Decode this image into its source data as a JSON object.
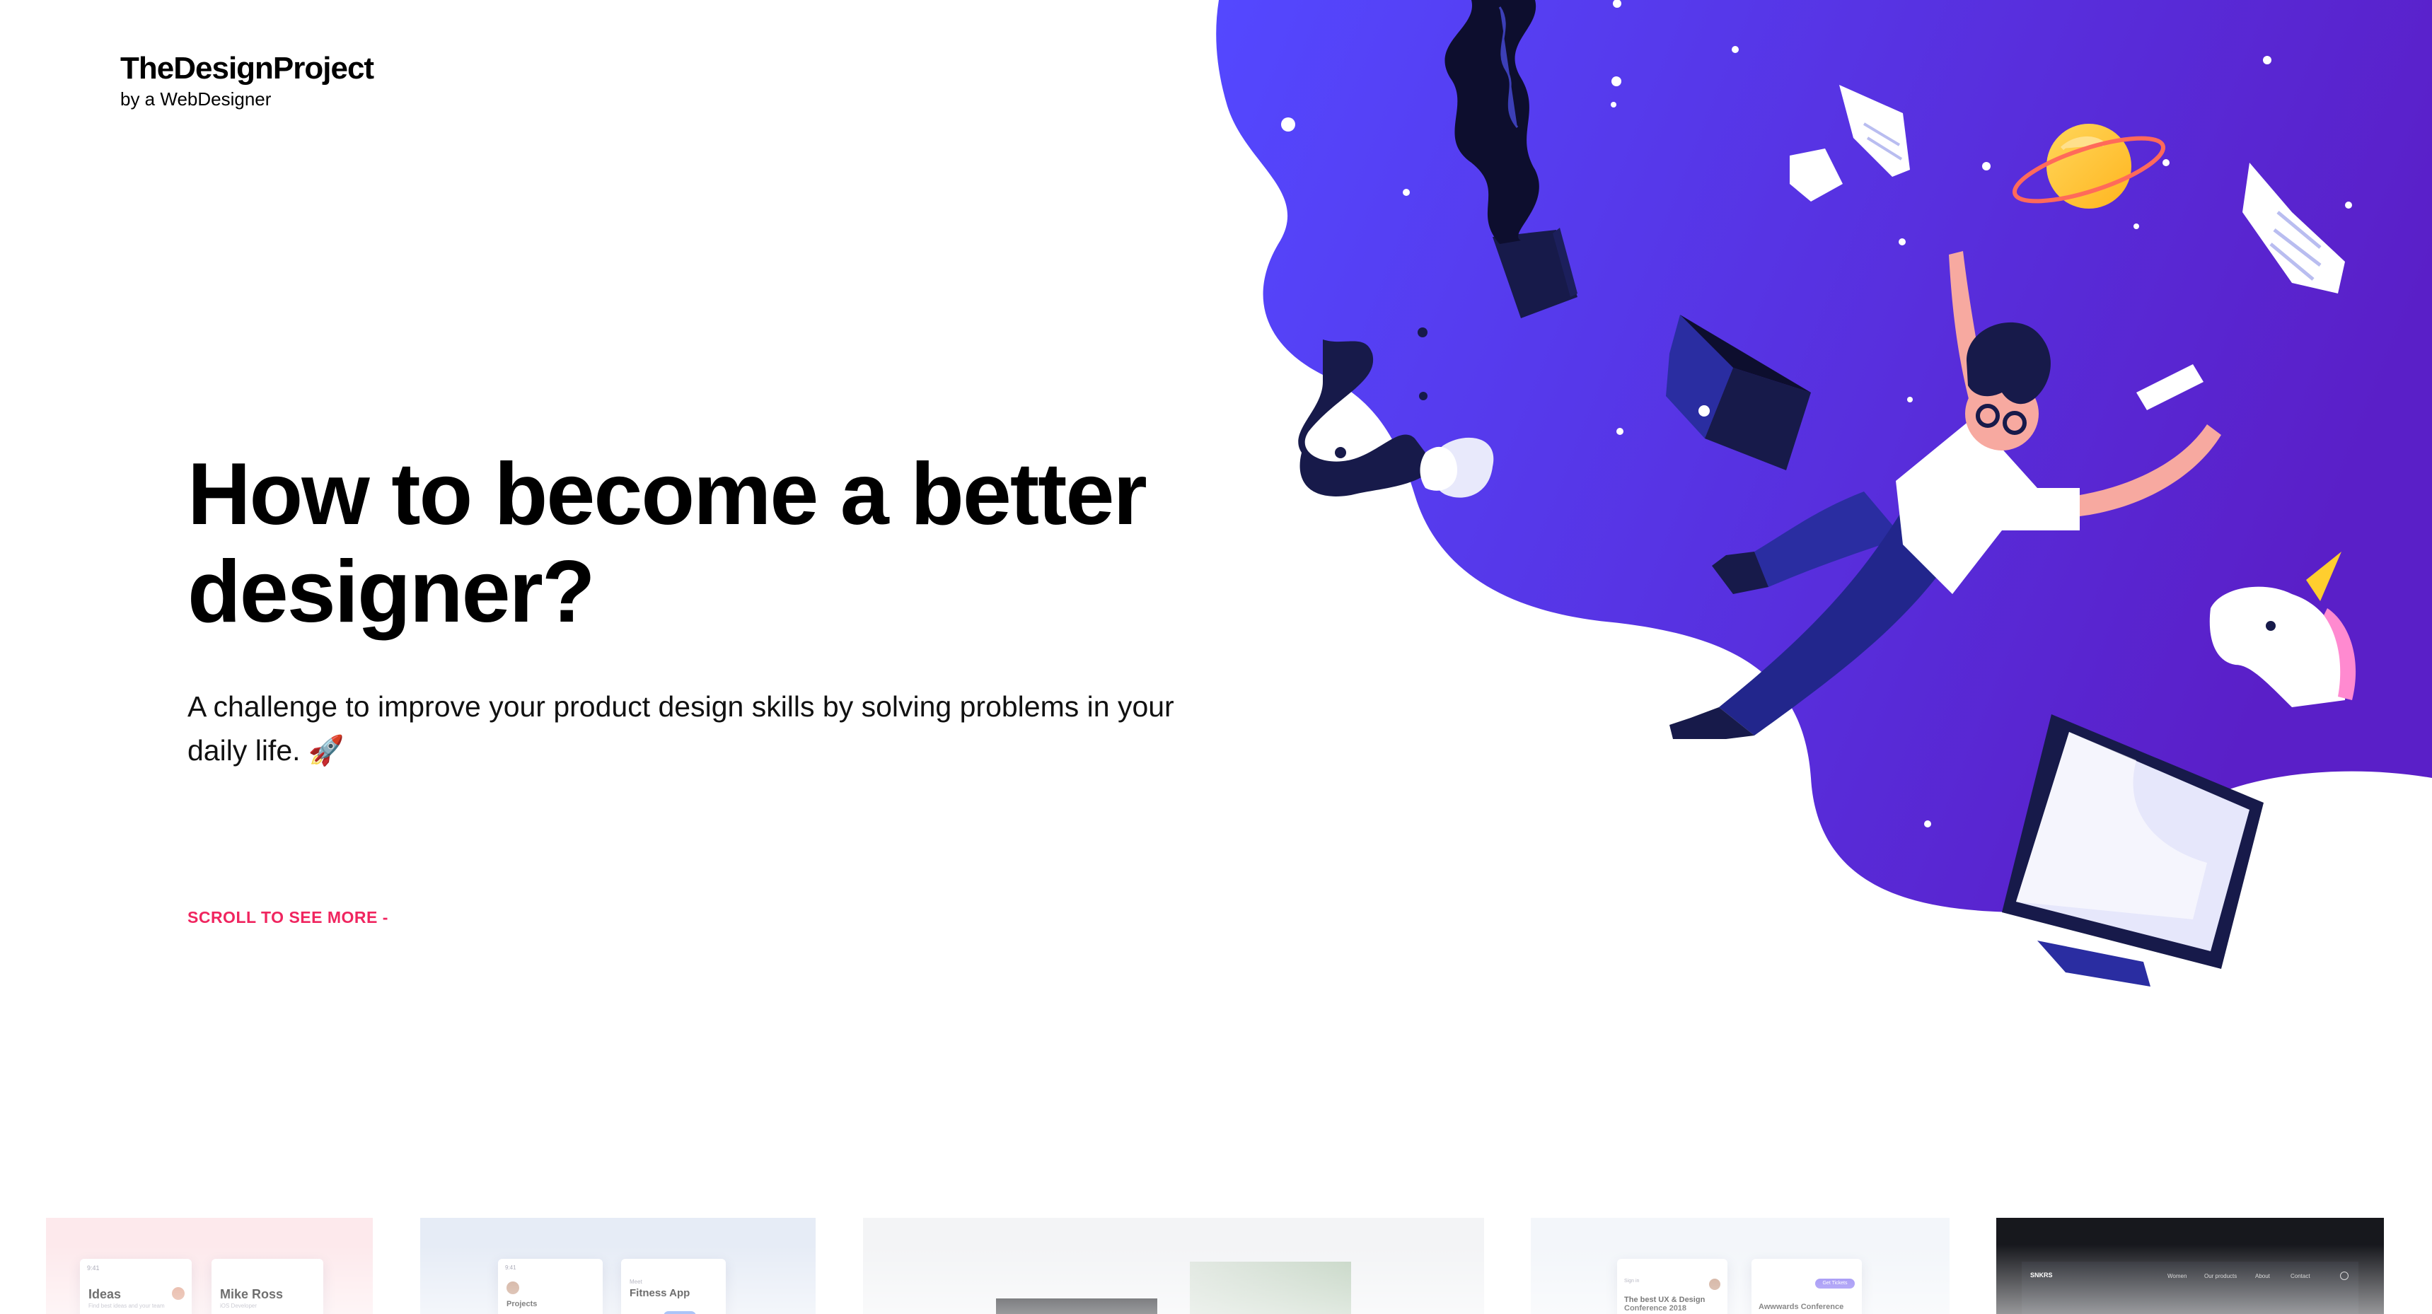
{
  "brand": {
    "name": "TheDesignProject",
    "tagline": "by a WebDesigner"
  },
  "hero": {
    "title": "How to become a better designer?",
    "subtitle": "A challenge to improve your product design skills by solving problems in your daily life.",
    "emoji": "🚀",
    "scroll_cta": "SCROLL TO SEE MORE -"
  },
  "colors": {
    "accent": "#f0255f",
    "illustration_gradient_start": "#5448ff",
    "illustration_gradient_end": "#5a1fc8",
    "planet": "#ffc53a",
    "text": "#000000"
  },
  "projects": [
    {
      "id": "ideas",
      "bg": "#fde9ec",
      "cards": [
        {
          "title": "Ideas",
          "caption": "Find best ideas and your team"
        },
        {
          "title": "Mike Ross",
          "caption": "iOS Developer"
        }
      ]
    },
    {
      "id": "fitness",
      "bg": "#e6ecf6",
      "cards": [
        {
          "title": "Projects",
          "caption": "9:41"
        },
        {
          "title": "Fitness App",
          "caption": "Meet"
        }
      ]
    },
    {
      "id": "plant",
      "bg": "#f3f4f6",
      "cards": []
    },
    {
      "id": "conference",
      "bg": "#f3f6fa",
      "cards": [
        {
          "title": "The best UX & Design Conference 2018",
          "caption": "Sign in"
        },
        {
          "title": "Awwwards Conference",
          "caption": "Get Tickets"
        }
      ]
    },
    {
      "id": "sneakers",
      "bg": "#17181d",
      "nav": [
        "SNKRS",
        "Women",
        "Our products",
        "About",
        "Contact"
      ]
    }
  ]
}
